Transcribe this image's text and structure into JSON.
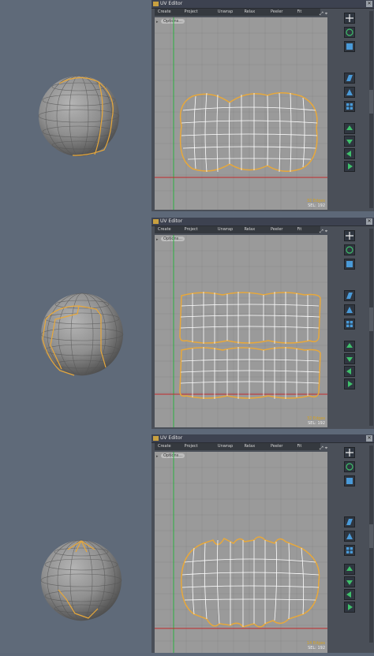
{
  "panels": [
    {
      "title": "UV Editor",
      "menu": [
        "Create",
        "Project",
        "Unwrap",
        "Relax",
        "Peeler",
        "Fit"
      ],
      "options_label": "Options...",
      "status_line1": "32 Edges",
      "status_line2": "SEL: 192"
    },
    {
      "title": "UV Editor",
      "menu": [
        "Create",
        "Project",
        "Unwrap",
        "Relax",
        "Peeler",
        "Fit"
      ],
      "options_label": "Options...",
      "status_line1": "32 Edges",
      "status_line2": "SEL: 192"
    },
    {
      "title": "UV Editor",
      "menu": [
        "Create",
        "Project",
        "Unwrap",
        "Relax",
        "Peeler",
        "Fit"
      ],
      "options_label": "Options...",
      "status_line1": "14 Edges",
      "status_line2": "SEL: 192"
    }
  ],
  "colors": {
    "seam": "#e8a83a",
    "uv_wire": "#ffffff",
    "grid": "#8a8a8a",
    "axis_v": "#2ab040",
    "axis_h": "#c0282a",
    "canvas": "#9a9a9a"
  },
  "icons": [
    "uv-editor-icon",
    "close-icon",
    "fit-view-icon",
    "pin-icon",
    "move-tool-icon",
    "rotate-tool-icon",
    "scale-tool-icon",
    "shear-tool-icon",
    "flip-icon",
    "arrow-up-icon",
    "arrow-down-icon",
    "arrow-left-icon",
    "arrow-right-icon"
  ]
}
